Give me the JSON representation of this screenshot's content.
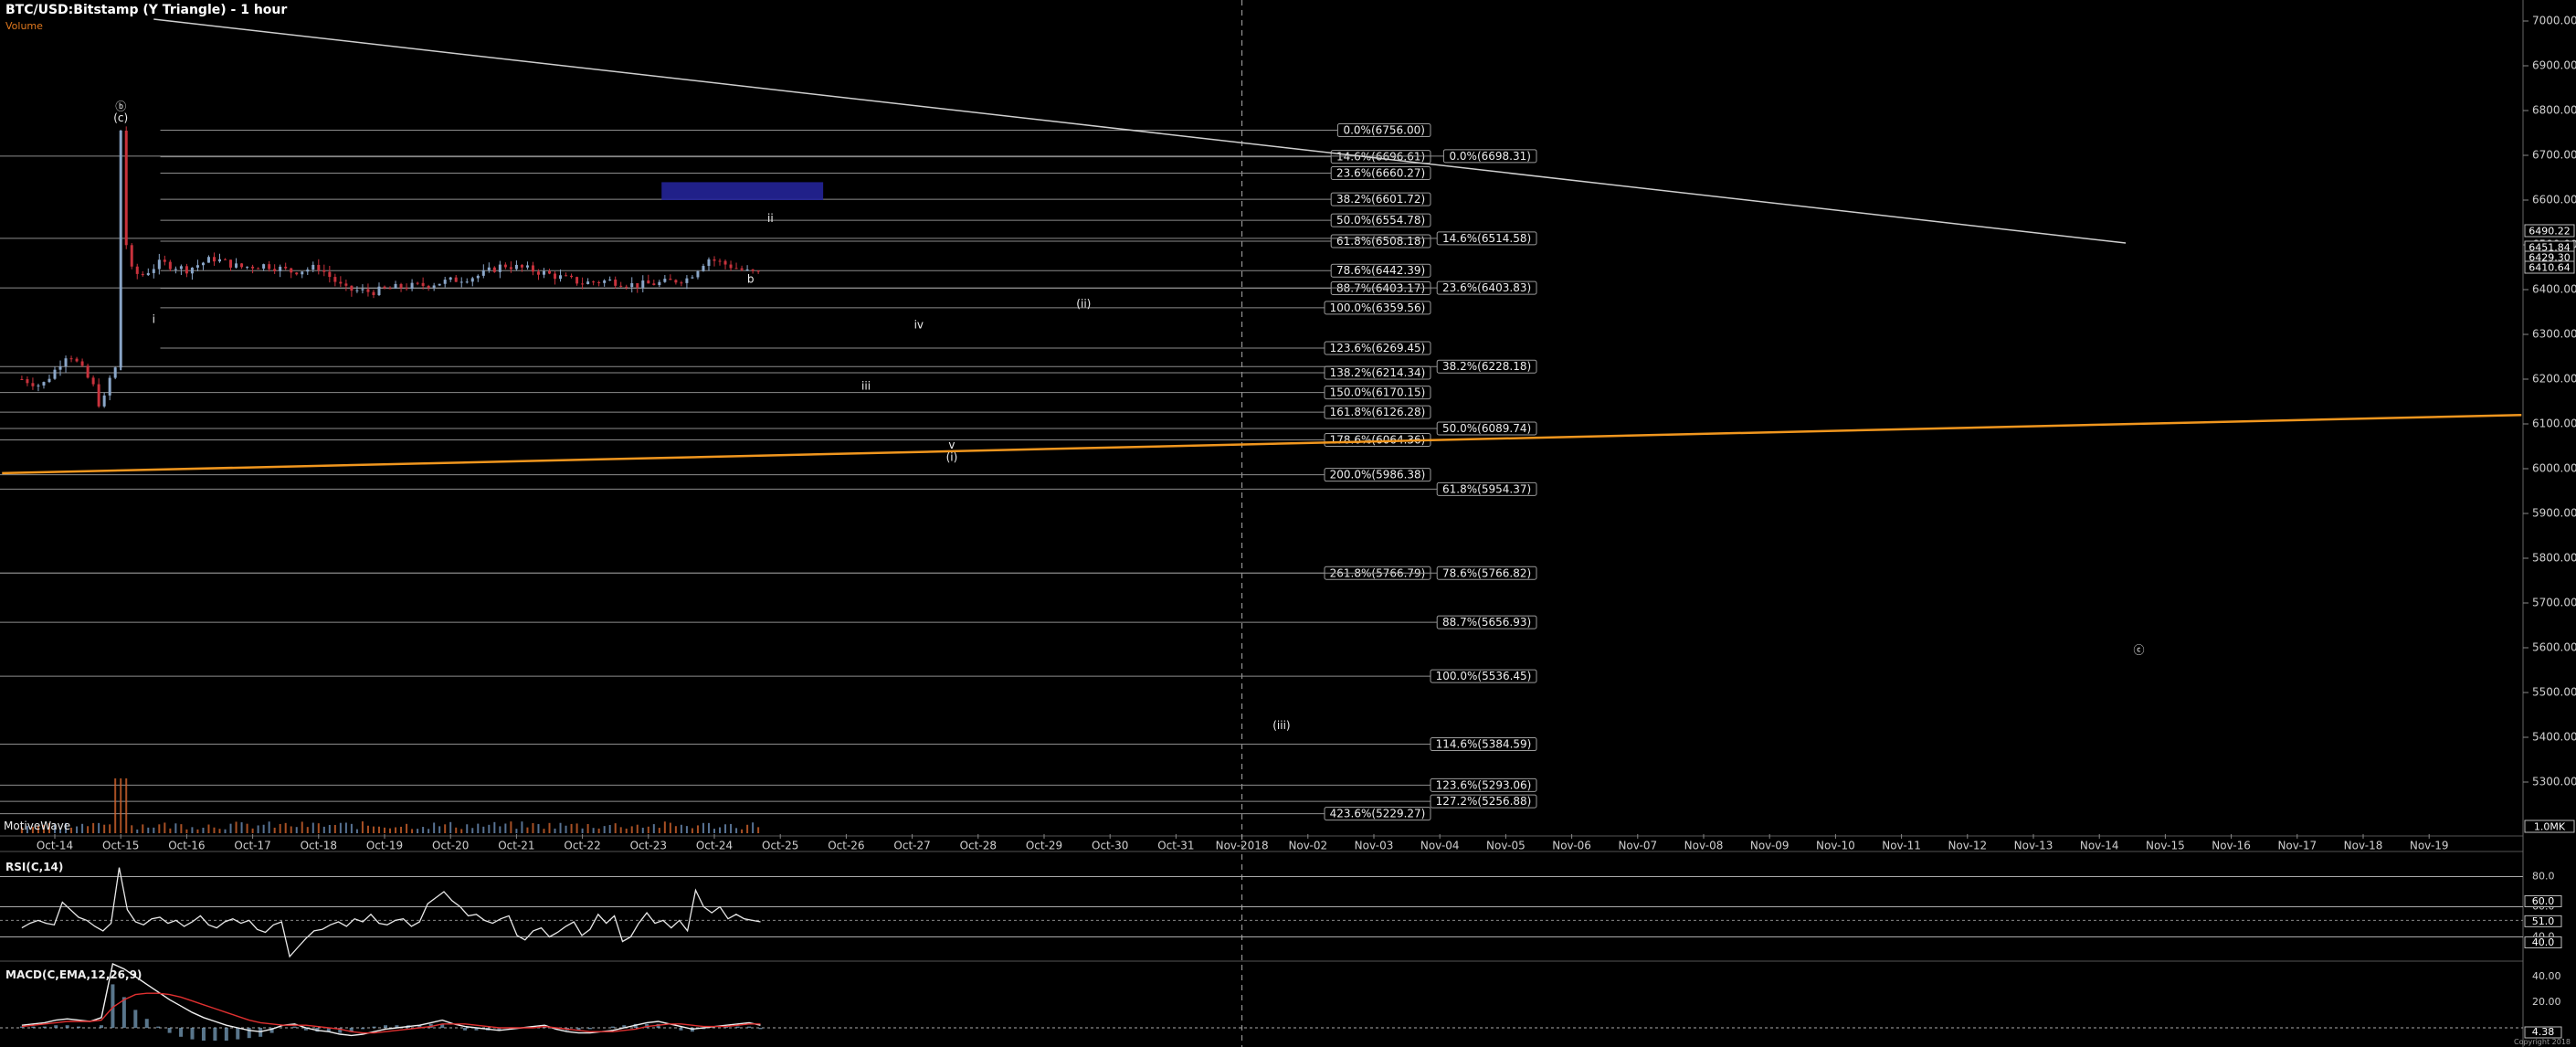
{
  "header": {
    "title": "BTC/USD:Bitstamp (Y Triangle) - 1 hour",
    "volume_label": "Volume",
    "motive_label": "MotiveWave",
    "rsi_label": "RSI(C,14)",
    "macd_label": "MACD(C,EMA,12,26,9)",
    "timestamp_label": "Copyright 2018"
  },
  "colors": {
    "background": "#000000",
    "up_candle": "#8aa6c8",
    "down_candle": "#c8323c",
    "trendline_orange": "#f0961e",
    "rectangle": "#232398",
    "level_line": "#8c8c8c"
  },
  "chart_data": [
    {
      "type": "candlestick",
      "title": "BTC/USD:Bitstamp (Y Triangle) - 1 hour",
      "x": {
        "ticks": [
          "Oct-14",
          "Oct-15",
          "Oct-16",
          "Oct-17",
          "Oct-18",
          "Oct-19",
          "Oct-20",
          "Oct-21",
          "Oct-22",
          "Oct-23",
          "Oct-24",
          "Oct-25",
          "Oct-26",
          "Oct-27",
          "Oct-28",
          "Oct-29",
          "Oct-30",
          "Oct-31",
          "Nov-2018",
          "Nov-02",
          "Nov-03",
          "Nov-04",
          "Nov-05",
          "Nov-06",
          "Nov-07",
          "Nov-08",
          "Nov-09",
          "Nov-10",
          "Nov-11",
          "Nov-12",
          "Nov-13",
          "Nov-14",
          "Nov-15",
          "Nov-16",
          "Nov-17",
          "Nov-18",
          "Nov-19"
        ]
      },
      "y": {
        "range": [
          5200,
          6960
        ],
        "ticks": [
          5300,
          5400,
          5500,
          5600,
          5700,
          5800,
          5900,
          6000,
          6100,
          6200,
          6300,
          6400,
          6500,
          6600,
          6700,
          6800,
          6900,
          7000
        ],
        "tick_labels": [
          "5300.00",
          "5400.00",
          "5500.00",
          "5600.00",
          "5700.00",
          "5800.00",
          "5900.00",
          "6000.00",
          "6100.00",
          "6200.00",
          "6300.00",
          "6400.00",
          "6500.00",
          "6600.00",
          "6700.00",
          "6800.00",
          "6900.00",
          "7000.00"
        ]
      },
      "price_tags": [
        "6490.22",
        "6451.84",
        "6429.30",
        "6410.64",
        "1.0MK"
      ],
      "price_points": [
        {
          "day": -0.5,
          "price": 6200
        },
        {
          "day": -0.2,
          "price": 6185
        },
        {
          "day": 0.0,
          "price": 6220
        },
        {
          "day": 0.2,
          "price": 6260
        },
        {
          "day": 0.4,
          "price": 6225
        },
        {
          "day": 0.6,
          "price": 6180
        },
        {
          "day": 0.7,
          "price": 6130
        },
        {
          "day": 0.85,
          "price": 6210
        },
        {
          "day": 0.95,
          "price": 6230
        },
        {
          "day": 1.0,
          "price": 6756
        },
        {
          "day": 1.1,
          "price": 6450
        },
        {
          "day": 1.3,
          "price": 6430
        },
        {
          "day": 1.6,
          "price": 6460
        },
        {
          "day": 2.0,
          "price": 6445
        },
        {
          "day": 2.4,
          "price": 6470
        },
        {
          "day": 2.8,
          "price": 6450
        },
        {
          "day": 3.2,
          "price": 6455
        },
        {
          "day": 3.6,
          "price": 6440
        },
        {
          "day": 4.0,
          "price": 6450
        },
        {
          "day": 4.4,
          "price": 6400
        },
        {
          "day": 4.8,
          "price": 6395
        },
        {
          "day": 5.2,
          "price": 6405
        },
        {
          "day": 5.6,
          "price": 6410
        },
        {
          "day": 6.0,
          "price": 6420
        },
        {
          "day": 6.4,
          "price": 6430
        },
        {
          "day": 6.8,
          "price": 6455
        },
        {
          "day": 7.2,
          "price": 6445
        },
        {
          "day": 7.6,
          "price": 6430
        },
        {
          "day": 8.0,
          "price": 6415
        },
        {
          "day": 8.4,
          "price": 6420
        },
        {
          "day": 8.8,
          "price": 6410
        },
        {
          "day": 9.2,
          "price": 6415
        },
        {
          "day": 9.6,
          "price": 6425
        },
        {
          "day": 9.9,
          "price": 6470
        },
        {
          "day": 10.2,
          "price": 6455
        },
        {
          "day": 10.5,
          "price": 6440
        },
        {
          "day": 10.7,
          "price": 6435
        }
      ],
      "fib_left": [
        {
          "label": "0.0%(6756.00)",
          "price": 6756.0
        },
        {
          "label": "14.6%(6696.61)",
          "price": 6696.61
        },
        {
          "label": "23.6%(6660.27)",
          "price": 6660.27
        },
        {
          "label": "38.2%(6601.72)",
          "price": 6601.72
        },
        {
          "label": "50.0%(6554.78)",
          "price": 6554.78
        },
        {
          "label": "61.8%(6508.18)",
          "price": 6508.18
        },
        {
          "label": "78.6%(6442.39)",
          "price": 6442.39
        },
        {
          "label": "88.7%(6403.17)",
          "price": 6403.17
        },
        {
          "label": "100.0%(6359.56)",
          "price": 6359.56
        },
        {
          "label": "123.6%(6269.45)",
          "price": 6269.45
        },
        {
          "label": "138.2%(6214.34)",
          "price": 6214.34
        },
        {
          "label": "150.0%(6170.15)",
          "price": 6170.15
        },
        {
          "label": "161.8%(6126.28)",
          "price": 6126.28
        },
        {
          "label": "178.6%(6064.36)",
          "price": 6064.36
        },
        {
          "label": "200.0%(5986.38)",
          "price": 5986.38
        },
        {
          "label": "261.8%(5766.79)",
          "price": 5766.79
        },
        {
          "label": "423.6%(5229.27)",
          "price": 5229.27
        }
      ],
      "fib_right": [
        {
          "label": "0.0%(6698.31)",
          "price": 6698.31
        },
        {
          "label": "14.6%(6514.58)",
          "price": 6514.58
        },
        {
          "label": "23.6%(6403.83)",
          "price": 6403.83
        },
        {
          "label": "38.2%(6228.18)",
          "price": 6228.18
        },
        {
          "label": "50.0%(6089.74)",
          "price": 6089.74
        },
        {
          "label": "61.8%(5954.37)",
          "price": 5954.37
        },
        {
          "label": "78.6%(5766.82)",
          "price": 5766.82
        },
        {
          "label": "88.7%(5656.93)",
          "price": 5656.93
        },
        {
          "label": "100.0%(5536.45)",
          "price": 5536.45
        },
        {
          "label": "114.6%(5384.59)",
          "price": 5384.59
        },
        {
          "label": "123.6%(5293.06)",
          "price": 5293.06
        },
        {
          "label": "127.2%(5256.88)",
          "price": 5256.88
        }
      ],
      "wave_labels": [
        {
          "text": "ⓑ",
          "day": 1.0,
          "price": 6808
        },
        {
          "text": "(c)",
          "day": 1.0,
          "price": 6783
        },
        {
          "text": "i",
          "day": 1.5,
          "price": 6333
        },
        {
          "text": "ii",
          "day": 10.85,
          "price": 6558
        },
        {
          "text": "b",
          "day": 10.55,
          "price": 6422
        },
        {
          "text": "iv",
          "day": 13.1,
          "price": 6320
        },
        {
          "text": "(ii)",
          "day": 15.6,
          "price": 6367
        },
        {
          "text": "iii",
          "day": 12.3,
          "price": 6184
        },
        {
          "text": "v",
          "day": 13.6,
          "price": 6052
        },
        {
          "text": "(i)",
          "day": 13.6,
          "price": 6024
        },
        {
          "text": "(iii)",
          "day": 18.6,
          "price": 5426
        },
        {
          "text": "ⓒ",
          "day": 31.6,
          "price": 5594
        }
      ],
      "rectangle": {
        "day_start": 9.2,
        "day_end": 11.65,
        "price_top": 6640,
        "price_bottom": 6600
      },
      "trendlines": [
        {
          "name": "upper",
          "day_start": 1.5,
          "price_start": 7004,
          "day_end": 31.4,
          "price_end": 6504
        },
        {
          "name": "lower",
          "day_start": -0.8,
          "price_start": 5990,
          "day_end": 37.4,
          "price_end": 6120
        }
      ],
      "current_day": 18.0
    },
    {
      "type": "line",
      "title": "RSI(C,14)",
      "y": {
        "ticks": [
          40,
          60,
          80
        ],
        "tick_labels": [
          "40.0",
          "60.0",
          "80.0"
        ]
      },
      "reference_line": 51.0,
      "tags": [
        "60.0",
        "51.0",
        "40.0"
      ],
      "values": [
        46,
        49,
        51,
        49,
        48,
        63,
        58,
        53,
        51,
        47,
        44,
        49,
        86,
        58,
        50,
        48,
        52,
        53,
        49,
        51,
        47,
        50,
        54,
        48,
        46,
        50,
        52,
        49,
        51,
        45,
        43,
        48,
        50,
        27,
        33,
        39,
        44,
        45,
        48,
        50,
        47,
        52,
        50,
        55,
        49,
        48,
        51,
        52,
        47,
        50,
        62,
        66,
        70,
        64,
        60,
        54,
        55,
        51,
        49,
        52,
        54,
        41,
        38,
        44,
        46,
        40,
        43,
        47,
        50,
        41,
        45,
        55,
        49,
        54,
        37,
        40,
        49,
        56,
        49,
        51,
        46,
        51,
        44,
        71,
        60,
        56,
        60,
        52,
        55,
        52,
        51,
        50
      ]
    },
    {
      "type": "line",
      "title": "MACD(C,EMA,12,26,9)",
      "y": {
        "ticks": [
          20,
          40
        ],
        "tick_labels": [
          "20.00",
          "40.00"
        ]
      },
      "tags": [
        "4.38"
      ],
      "macd": [
        2,
        3,
        4,
        6,
        7,
        6,
        5,
        8,
        50,
        46,
        40,
        34,
        28,
        22,
        17,
        12,
        8,
        5,
        2,
        0,
        -2,
        -3,
        -1,
        2,
        3,
        0,
        -2,
        -3,
        -5,
        -6,
        -5,
        -3,
        -1,
        0,
        1,
        2,
        4,
        6,
        3,
        1,
        0,
        -1,
        -2,
        -1,
        0,
        1,
        2,
        -1,
        -3,
        -4,
        -4,
        -3,
        -2,
        0,
        2,
        4,
        5,
        3,
        1,
        -1,
        0,
        1,
        2,
        3,
        4,
        2
      ],
      "signal": [
        1,
        2,
        3,
        4,
        5,
        5,
        5,
        6,
        16,
        22,
        26,
        27,
        27,
        26,
        24,
        21,
        18,
        15,
        12,
        9,
        6,
        4,
        3,
        2,
        2,
        2,
        1,
        0,
        -1,
        -3,
        -4,
        -4,
        -3,
        -2,
        -1,
        0,
        1,
        3,
        3,
        3,
        2,
        1,
        0,
        0,
        0,
        0,
        1,
        0,
        -1,
        -2,
        -3,
        -3,
        -3,
        -2,
        -1,
        1,
        2,
        3,
        3,
        2,
        1,
        1,
        1,
        2,
        3,
        3
      ]
    }
  ]
}
